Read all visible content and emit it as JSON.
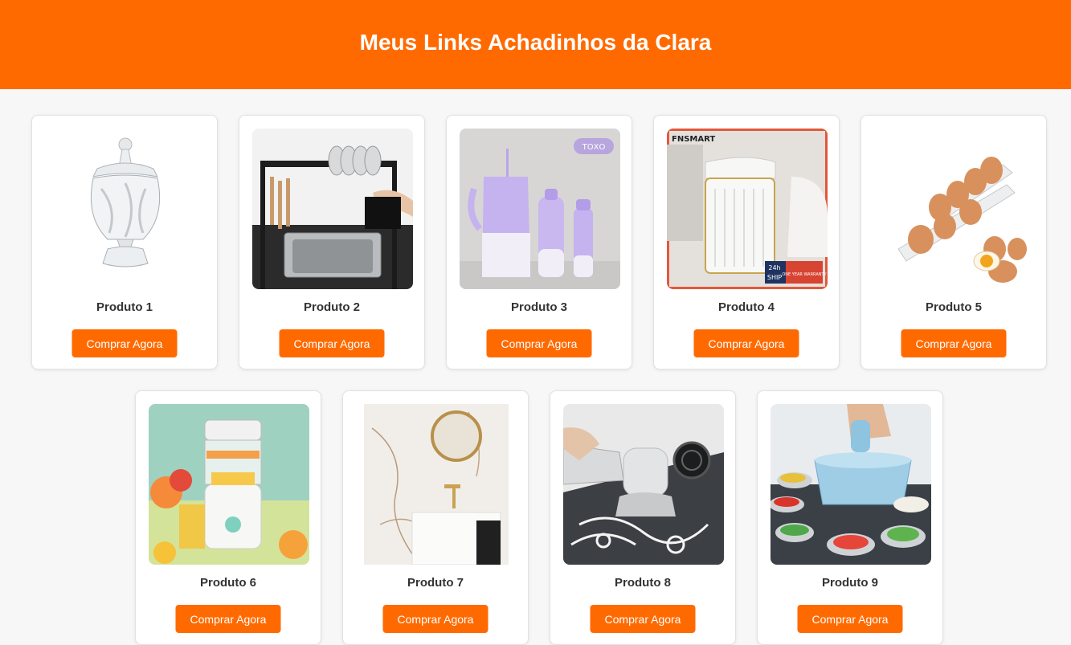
{
  "header": {
    "title": "Meus Links Achadinhos da Clara"
  },
  "products": [
    {
      "name": "Produto 1",
      "button": "Comprar Agora",
      "icon": "crystal-candy-jar-image"
    },
    {
      "name": "Produto 2",
      "button": "Comprar Agora",
      "icon": "dish-rack-image"
    },
    {
      "name": "Produto 3",
      "button": "Comprar Agora",
      "icon": "bottle-set-image",
      "image_badge": "ΤΟΧΟ"
    },
    {
      "name": "Produto 4",
      "button": "Comprar Agora",
      "icon": "trash-bin-image",
      "brand_text": "FNSMART",
      "badge_hours": "24h",
      "badge_ship": "SHIP",
      "badge_warranty": "ONE YEAR WARRANTY"
    },
    {
      "name": "Produto 5",
      "button": "Comprar Agora",
      "icon": "egg-holder-image"
    },
    {
      "name": "Produto 6",
      "button": "Comprar Agora",
      "icon": "juicer-image"
    },
    {
      "name": "Produto 7",
      "button": "Comprar Agora",
      "icon": "bathroom-mirror-image"
    },
    {
      "name": "Produto 8",
      "button": "Comprar Agora",
      "icon": "cleaning-brush-image"
    },
    {
      "name": "Produto 9",
      "button": "Comprar Agora",
      "icon": "vegetable-slicer-image"
    }
  ],
  "colors": {
    "accent": "#ff6a00",
    "background": "#f7f7f7",
    "card": "#ffffff"
  }
}
